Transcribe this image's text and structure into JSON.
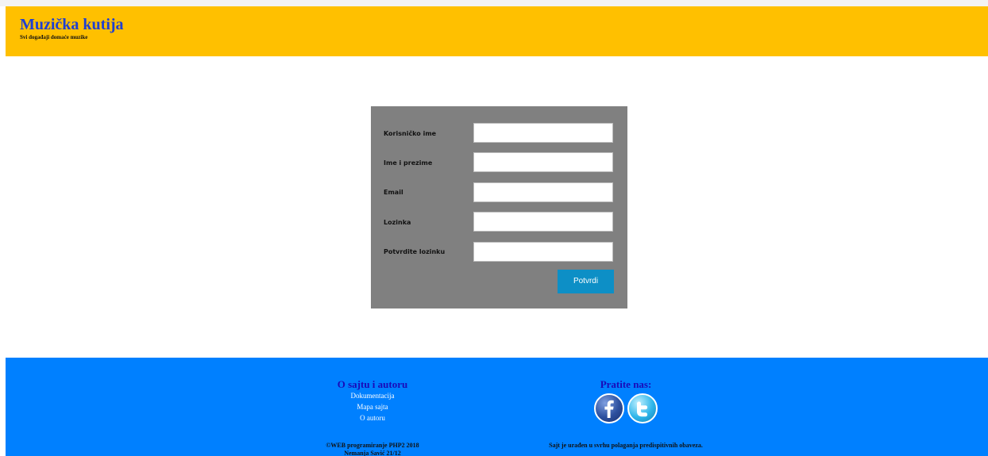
{
  "header": {
    "title": "Muzička kutija",
    "subtitle": "Svi događaji domaće muzike"
  },
  "form": {
    "fields": [
      {
        "label": "Korisničko ime",
        "value": ""
      },
      {
        "label": "Ime i prezime",
        "value": ""
      },
      {
        "label": "Email",
        "value": ""
      },
      {
        "label": "Lozinka",
        "value": ""
      },
      {
        "label": "Potvrdite lozinku",
        "value": ""
      }
    ],
    "submit_label": "Potvrdi"
  },
  "footer": {
    "about": {
      "heading": "O sajtu i autoru",
      "links": [
        "Dokumentacija",
        "Mapa sajta",
        "O autoru"
      ]
    },
    "follow": {
      "heading": "Pratite nas:",
      "icons": [
        "facebook-icon",
        "twitter-icon"
      ]
    },
    "copyright": "©WEB programiranje PHP2 2018",
    "author": "Nemanja Savić 21/12",
    "note": "Sajt je urađen u svrhu polaganja predispitivnih obaveza."
  },
  "colors": {
    "header_bg": "#ffc000",
    "title_color": "#1f3fd1",
    "panel_bg": "#808080",
    "button_bg": "#0d8fc6",
    "footer_bg": "#0080ff",
    "footer_heading": "#1a0ab8"
  }
}
